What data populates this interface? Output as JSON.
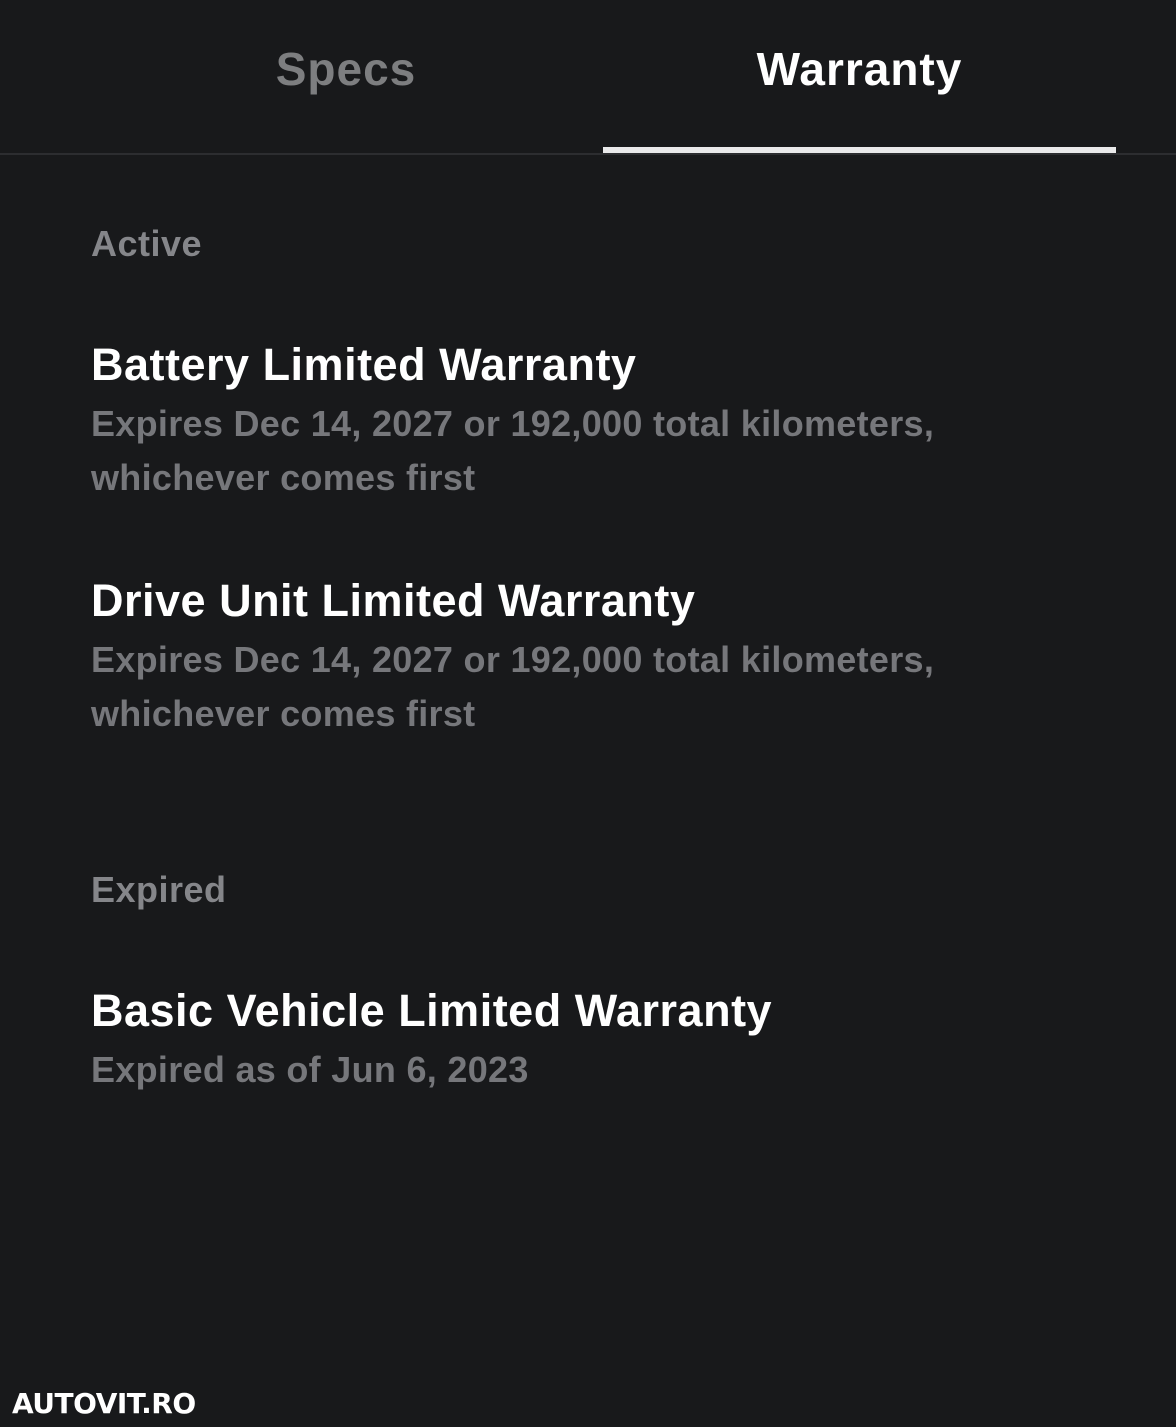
{
  "tabs": {
    "specs_label": "Specs",
    "warranty_label": "Warranty",
    "selected": "Warranty"
  },
  "sections": {
    "active_title": "Active",
    "expired_title": "Expired"
  },
  "warranties": {
    "battery": {
      "title": "Battery Limited Warranty",
      "description": "Expires Dec 14, 2027 or 192,000 total kilometers, whichever comes first"
    },
    "drive_unit": {
      "title": "Drive Unit Limited Warranty",
      "description": "Expires Dec 14, 2027 or 192,000 total kilometers, whichever comes first"
    },
    "basic_vehicle": {
      "title": "Basic Vehicle Limited Warranty",
      "description": "Expired as of Jun 6, 2023"
    }
  },
  "watermark": "AUTOVIT.RO",
  "colors": {
    "background": "#18191b",
    "active_tab_text": "#ffffff",
    "inactive_tab_text": "#7d7e80",
    "tab_indicator": "#e9e9ea",
    "section_header": "#85868a",
    "item_description": "#76777b"
  }
}
